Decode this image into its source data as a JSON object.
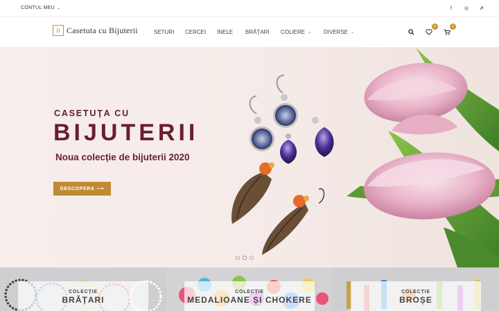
{
  "topbar": {
    "account_label": "CONTUL MEU",
    "socials": [
      {
        "name": "facebook-icon",
        "glyph": "f"
      },
      {
        "name": "instagram-icon",
        "glyph": "◎"
      },
      {
        "name": "pinterest-icon",
        "glyph": "𝓅"
      }
    ]
  },
  "header": {
    "logo_text": "Casetuta cu Bijuterii",
    "logo_mark": "B",
    "nav": [
      {
        "label": "SETURI",
        "caret": false
      },
      {
        "label": "CERCEI",
        "caret": false
      },
      {
        "label": "INELE",
        "caret": false
      },
      {
        "label": "BRĂȚARI",
        "caret": false
      },
      {
        "label": "COLIERE",
        "caret": true
      },
      {
        "label": "DIVERSE",
        "caret": true
      }
    ],
    "wishlist_count": "0",
    "cart_count": "0"
  },
  "hero": {
    "pretitle": "CASETUȚA CU",
    "title": "BIJUTERII",
    "subtitle": "Noua colecție de bijuterii 2020",
    "button_label": "DESCOPERA",
    "slide_count": 3,
    "active_slide": 2
  },
  "collections": [
    {
      "kicker": "COLECȚIE",
      "name": "BRĂȚARI"
    },
    {
      "kicker": "COLECȚIE",
      "name": "MEDALIOANE ȘI CHOKERE"
    },
    {
      "kicker": "COLECȚIE",
      "name": "BROȘE"
    }
  ],
  "colors": {
    "accent": "#c08a35",
    "title": "#6b1d2f"
  }
}
